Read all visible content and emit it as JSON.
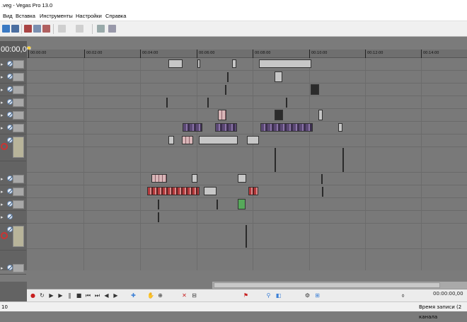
{
  "window": {
    "title": ".veg - Vegas Pro 13.0"
  },
  "menu": {
    "items": [
      "Вид",
      "Вставка",
      "Инструменты",
      "Настройки",
      "Справка"
    ]
  },
  "timecode": {
    "display": "00:00,00"
  },
  "ruler": {
    "ticks": [
      "00:00:00",
      "00:02:00",
      "00:04:00",
      "00:06:00",
      "00:08:00",
      "00:10:00",
      "00:12:00",
      "00:14:00"
    ]
  },
  "transport": {
    "time": "00:00:00,00"
  },
  "status": {
    "left": "10",
    "right": "Время записи (2 канала"
  },
  "colors": {
    "accent": "#ffd23a",
    "record": "#c82020",
    "selected": "#3b7fd6"
  }
}
